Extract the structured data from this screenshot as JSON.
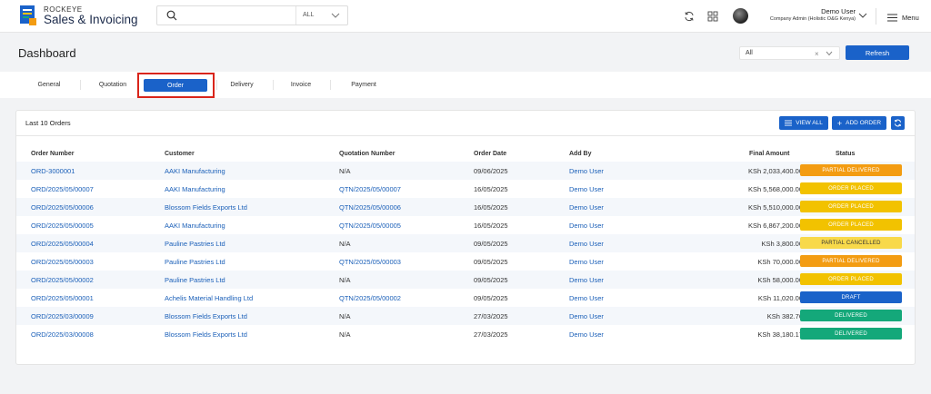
{
  "app": {
    "brand_top": "ROCKEYE",
    "brand_main": "Sales & Invoicing"
  },
  "search": {
    "placeholder": "",
    "scope": "ALL"
  },
  "user": {
    "name": "Demo User",
    "role": "Company Admin (Holistic O&G Kenya)"
  },
  "menu_label": "Menu",
  "page": {
    "title": "Dashboard",
    "filter_value": "All",
    "refresh_label": "Refresh"
  },
  "tabs": [
    {
      "label": "General"
    },
    {
      "label": "Quotation"
    },
    {
      "label": "Order"
    },
    {
      "label": "Delivery"
    },
    {
      "label": "Invoice"
    },
    {
      "label": "Payment"
    }
  ],
  "orders_card": {
    "title": "Last 10 Orders",
    "view_all_label": "VIEW ALL",
    "add_order_label": "ADD ORDER",
    "columns": [
      "Order Number",
      "Customer",
      "Quotation Number",
      "Order Date",
      "Add By",
      "Final Amount",
      "Status"
    ],
    "rows": [
      {
        "order": "ORD-3000001",
        "customer": "AAKI Manufacturing",
        "quotation": "N/A",
        "date": "09/06/2025",
        "added_by": "Demo User",
        "amount": "KSh 2,033,400.00",
        "status": "PARTIAL DELIVERED"
      },
      {
        "order": "ORD/2025/05/00007",
        "customer": "AAKI Manufacturing",
        "quotation": "QTN/2025/05/00007",
        "date": "16/05/2025",
        "added_by": "Demo User",
        "amount": "KSh 5,568,000.00",
        "status": "ORDER PLACED"
      },
      {
        "order": "ORD/2025/05/00006",
        "customer": "Blossom Fields Exports Ltd",
        "quotation": "QTN/2025/05/00006",
        "date": "16/05/2025",
        "added_by": "Demo User",
        "amount": "KSh 5,510,000.00",
        "status": "ORDER PLACED"
      },
      {
        "order": "ORD/2025/05/00005",
        "customer": "AAKI Manufacturing",
        "quotation": "QTN/2025/05/00005",
        "date": "16/05/2025",
        "added_by": "Demo User",
        "amount": "KSh 6,867,200.00",
        "status": "ORDER PLACED"
      },
      {
        "order": "ORD/2025/05/00004",
        "customer": "Pauline Pastries Ltd",
        "quotation": "N/A",
        "date": "09/05/2025",
        "added_by": "Demo User",
        "amount": "KSh 3,800.00",
        "status": "PARTIAL CANCELLED"
      },
      {
        "order": "ORD/2025/05/00003",
        "customer": "Pauline Pastries Ltd",
        "quotation": "QTN/2025/05/00003",
        "date": "09/05/2025",
        "added_by": "Demo User",
        "amount": "KSh 70,000.00",
        "status": "PARTIAL DELIVERED"
      },
      {
        "order": "ORD/2025/05/00002",
        "customer": "Pauline Pastries Ltd",
        "quotation": "N/A",
        "date": "09/05/2025",
        "added_by": "Demo User",
        "amount": "KSh 58,000.00",
        "status": "ORDER PLACED"
      },
      {
        "order": "ORD/2025/05/00001",
        "customer": "Achelis Material Handling Ltd",
        "quotation": "QTN/2025/05/00002",
        "date": "09/05/2025",
        "added_by": "Demo User",
        "amount": "KSh 11,020.00",
        "status": "DRAFT"
      },
      {
        "order": "ORD/2025/03/00009",
        "customer": "Blossom Fields Exports Ltd",
        "quotation": "N/A",
        "date": "27/03/2025",
        "added_by": "Demo User",
        "amount": "KSh 382.76",
        "status": "DELIVERED"
      },
      {
        "order": "ORD/2025/03/00008",
        "customer": "Blossom Fields Exports Ltd",
        "quotation": "N/A",
        "date": "27/03/2025",
        "added_by": "Demo User",
        "amount": "KSh 38,180.17",
        "status": "DELIVERED"
      }
    ]
  },
  "status_colors": {
    "PARTIAL DELIVERED": {
      "bg": "#f39c12",
      "fg": "#ffffff"
    },
    "ORDER PLACED": {
      "bg": "#f2c200",
      "fg": "#ffffff"
    },
    "PARTIAL CANCELLED": {
      "bg": "#f8d94a",
      "fg": "#333333"
    },
    "DRAFT": {
      "bg": "#1a62c9",
      "fg": "#ffffff"
    },
    "DELIVERED": {
      "bg": "#14a87a",
      "fg": "#ffffff"
    }
  },
  "accent_color": "#1a62c9",
  "highlight_color": "#d9241a"
}
